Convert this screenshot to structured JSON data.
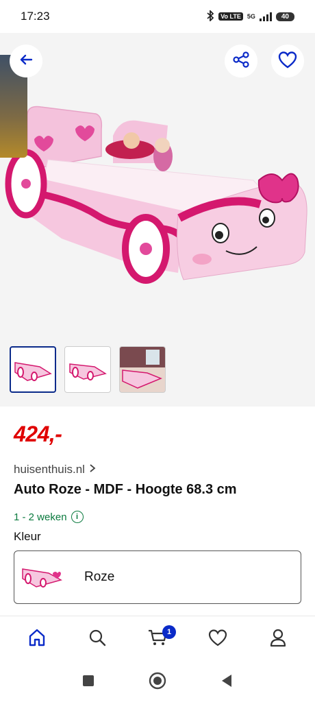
{
  "status_bar": {
    "time": "17:23",
    "volte": "Vo LTE",
    "network": "5G",
    "battery": "40"
  },
  "gallery": {
    "thumbnails": [
      {
        "name": "thumb-1",
        "active": true
      },
      {
        "name": "thumb-2",
        "active": false
      },
      {
        "name": "thumb-3",
        "active": false
      }
    ]
  },
  "product": {
    "price": "424,-",
    "seller": "huisenthuis.nl",
    "title": "Auto Roze - MDF - Hoogte 68.3 cm",
    "delivery": "1 - 2 weken",
    "color_label": "Kleur",
    "color_value": "Roze"
  },
  "bottom_nav": {
    "items": [
      "home-icon",
      "search-icon",
      "cart-icon",
      "heart-icon",
      "user-icon"
    ],
    "cart_count": "1"
  },
  "colors": {
    "accent_blue": "#0a2ac8",
    "price_red": "#e00000",
    "delivery_green": "#0a7a3e",
    "bed_pink": "#f2b6d4",
    "bed_magenta": "#d4186e"
  }
}
